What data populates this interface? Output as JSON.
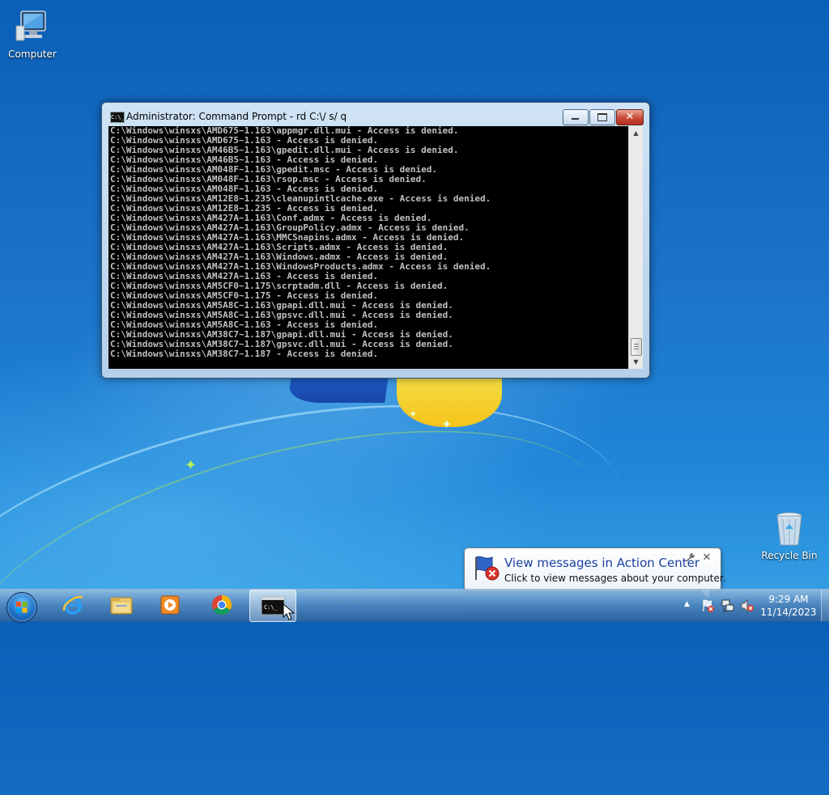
{
  "desktop": {
    "icons": [
      {
        "label": "Computer"
      },
      {
        "label": "Recycle Bin"
      }
    ]
  },
  "cmd_window": {
    "title": "Administrator:  Command Prompt - rd  C:\\/ s/ q",
    "lines": [
      "C:\\Windows\\winsxs\\AMD675~1.163\\appmgr.dll.mui - Access is denied.",
      "C:\\Windows\\winsxs\\AMD675~1.163 - Access is denied.",
      "C:\\Windows\\winsxs\\AM46B5~1.163\\gpedit.dll.mui - Access is denied.",
      "C:\\Windows\\winsxs\\AM46B5~1.163 - Access is denied.",
      "C:\\Windows\\winsxs\\AM048F~1.163\\gpedit.msc - Access is denied.",
      "C:\\Windows\\winsxs\\AM048F~1.163\\rsop.msc - Access is denied.",
      "C:\\Windows\\winsxs\\AM048F~1.163 - Access is denied.",
      "C:\\Windows\\winsxs\\AM12E8~1.235\\cleanupintlcache.exe - Access is denied.",
      "C:\\Windows\\winsxs\\AM12E8~1.235 - Access is denied.",
      "C:\\Windows\\winsxs\\AM427A~1.163\\Conf.admx - Access is denied.",
      "C:\\Windows\\winsxs\\AM427A~1.163\\GroupPolicy.admx - Access is denied.",
      "C:\\Windows\\winsxs\\AM427A~1.163\\MMCSnapins.admx - Access is denied.",
      "C:\\Windows\\winsxs\\AM427A~1.163\\Scripts.admx - Access is denied.",
      "C:\\Windows\\winsxs\\AM427A~1.163\\Windows.admx - Access is denied.",
      "C:\\Windows\\winsxs\\AM427A~1.163\\WindowsProducts.admx - Access is denied.",
      "C:\\Windows\\winsxs\\AM427A~1.163 - Access is denied.",
      "C:\\Windows\\winsxs\\AM5CF0~1.175\\scrptadm.dll - Access is denied.",
      "C:\\Windows\\winsxs\\AM5CF0~1.175 - Access is denied.",
      "C:\\Windows\\winsxs\\AM5A8C~1.163\\gpapi.dll.mui - Access is denied.",
      "C:\\Windows\\winsxs\\AM5A8C~1.163\\gpsvc.dll.mui - Access is denied.",
      "C:\\Windows\\winsxs\\AM5A8C~1.163 - Access is denied.",
      "C:\\Windows\\winsxs\\AM38C7~1.187\\gpapi.dll.mui - Access is denied.",
      "C:\\Windows\\winsxs\\AM38C7~1.187\\gpsvc.dll.mui - Access is denied.",
      "C:\\Windows\\winsxs\\AM38C7~1.187 - Access is denied."
    ],
    "icon_text": "C:\\_"
  },
  "balloon": {
    "title": "View messages in Action Center",
    "body": "Click to view messages about your computer.",
    "close_glyph": "✕"
  },
  "taskbar": {
    "apps": [
      {
        "name": "internet-explorer-icon"
      },
      {
        "name": "windows-explorer-icon"
      },
      {
        "name": "media-player-icon"
      },
      {
        "name": "chrome-icon"
      },
      {
        "name": "command-prompt-icon",
        "active": true
      }
    ],
    "tray_arrow": "▲",
    "clock": {
      "time": "9:29 AM",
      "date": "11/14/2023"
    }
  },
  "colors": {
    "console_bg": "#000000",
    "console_fg": "#c0c0c0",
    "balloon_title": "#1a3fa0",
    "close_button": "#c84a37"
  }
}
